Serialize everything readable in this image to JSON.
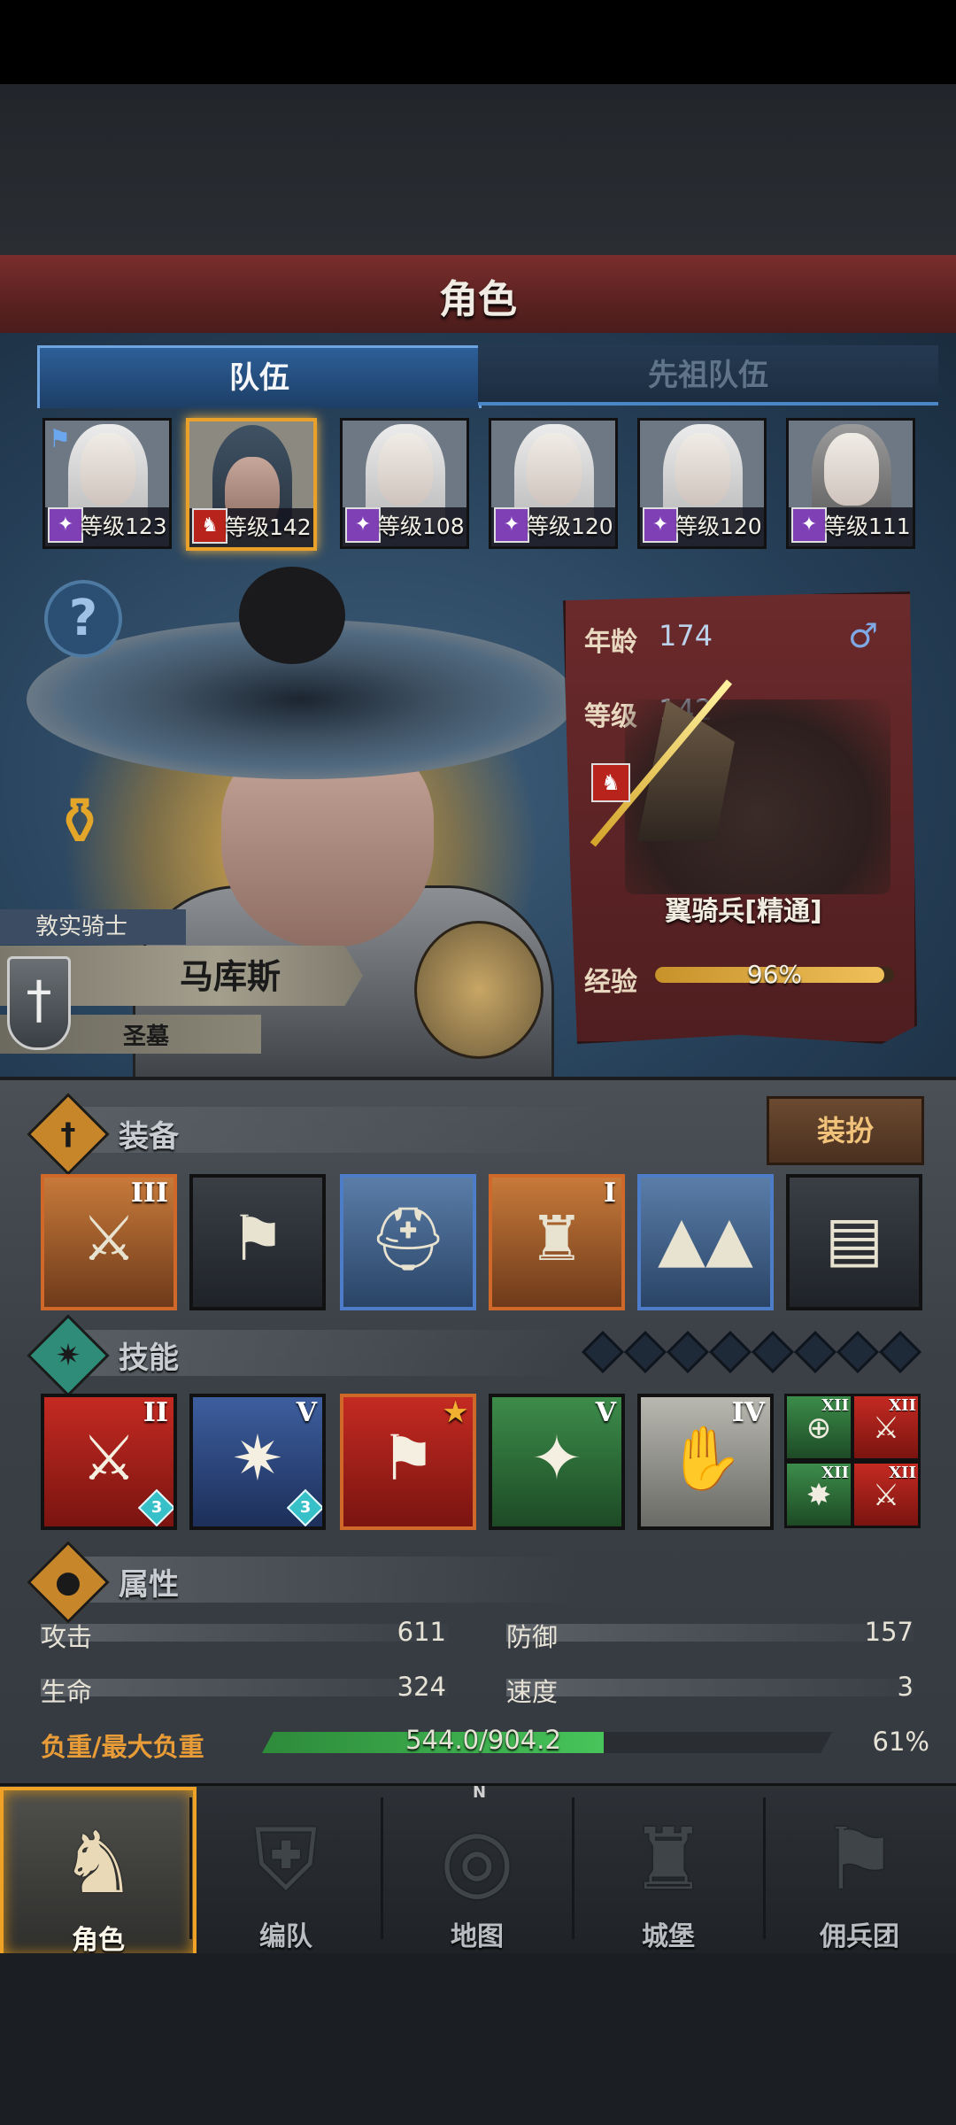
{
  "header": {
    "title": "角色"
  },
  "tabs": [
    {
      "label": "队伍",
      "active": true
    },
    {
      "label": "先祖队伍",
      "active": false
    }
  ],
  "party": [
    {
      "level": "等级123",
      "selected": false,
      "flag": true
    },
    {
      "level": "等级142",
      "selected": true,
      "flag": false
    },
    {
      "level": "等级108",
      "selected": false,
      "flag": false
    },
    {
      "level": "等级120",
      "selected": false,
      "flag": false
    },
    {
      "level": "等级120",
      "selected": false,
      "flag": false
    },
    {
      "level": "等级111",
      "selected": false,
      "flag": false
    }
  ],
  "hero": {
    "title": "敦实骑士",
    "name": "马库斯",
    "subtitle": "圣墓"
  },
  "info": {
    "age_label": "年龄",
    "age_value": "174",
    "gender": "♂",
    "level_label": "等级",
    "level_value": "142",
    "unit_name": "翼骑兵[精通]",
    "exp_label": "经验",
    "exp_text": "96%",
    "exp_fraction": 0.96
  },
  "equipment": {
    "title": "装备",
    "outfit_label": "装扮",
    "slots": [
      {
        "name": "equip-slot-weapon",
        "tier": "III",
        "glyph": "⚔",
        "style": "orange"
      },
      {
        "name": "equip-slot-banner",
        "tier": "",
        "glyph": "⚑",
        "style": "dark"
      },
      {
        "name": "equip-slot-helmet",
        "tier": "",
        "glyph": "⛑",
        "style": "blue"
      },
      {
        "name": "equip-slot-armor",
        "tier": "I",
        "glyph": "♜",
        "style": "orange"
      },
      {
        "name": "equip-slot-boots",
        "tier": "",
        "glyph": "▲▲",
        "style": "blue"
      },
      {
        "name": "equip-slot-book",
        "tier": "",
        "glyph": "▤",
        "style": "dark"
      }
    ]
  },
  "skills": {
    "title": "技能",
    "items": [
      {
        "name": "skill-slash",
        "tier": "II",
        "badge": "3",
        "glyph": "⚔",
        "style": "red"
      },
      {
        "name": "skill-prayer",
        "tier": "V",
        "badge": "3",
        "glyph": "✷",
        "style": "navy"
      },
      {
        "name": "skill-charge-flag",
        "tier": "★",
        "badge": "",
        "glyph": "⚑",
        "style": "redorange"
      },
      {
        "name": "skill-gem-burst",
        "tier": "V",
        "badge": "",
        "glyph": "✦",
        "style": "green"
      },
      {
        "name": "skill-gem-hand",
        "tier": "IV",
        "badge": "",
        "glyph": "✋",
        "style": "grey"
      }
    ],
    "minis": [
      {
        "name": "mini-skill-target",
        "tier": "XII",
        "glyph": "⊕",
        "style": "green"
      },
      {
        "name": "mini-skill-sword-1",
        "tier": "XII",
        "glyph": "⚔",
        "style": "red"
      },
      {
        "name": "mini-skill-burst",
        "tier": "XII",
        "glyph": "✸",
        "style": "green"
      },
      {
        "name": "mini-skill-sword-2",
        "tier": "XII",
        "glyph": "⚔",
        "style": "red"
      }
    ]
  },
  "attributes": {
    "title": "属性",
    "attack_label": "攻击",
    "attack_value": "611",
    "defense_label": "防御",
    "defense_value": "157",
    "hp_label": "生命",
    "hp_value": "324",
    "speed_label": "速度",
    "speed_value": "3",
    "load_label": "负重/最大负重",
    "load_text": "544.0/904.2",
    "load_pct": "61%",
    "load_fraction": 0.6
  },
  "nav": [
    {
      "label": "角色",
      "icon": "knight-icon",
      "glyph": "♞",
      "active": true
    },
    {
      "label": "编队",
      "icon": "helmet-icon",
      "glyph": "⛨",
      "active": false
    },
    {
      "label": "地图",
      "icon": "compass-icon",
      "glyph": "◎",
      "active": false
    },
    {
      "label": "城堡",
      "icon": "castle-icon",
      "glyph": "♜",
      "active": false
    },
    {
      "label": "佣兵团",
      "icon": "banner-icon",
      "glyph": "⚑",
      "active": false
    }
  ],
  "compass_n": "N",
  "colors": {
    "accent": "#f0a226",
    "title_red": "#5b2221",
    "panel_blue": "#27415a",
    "load_green": "#47c45a"
  }
}
